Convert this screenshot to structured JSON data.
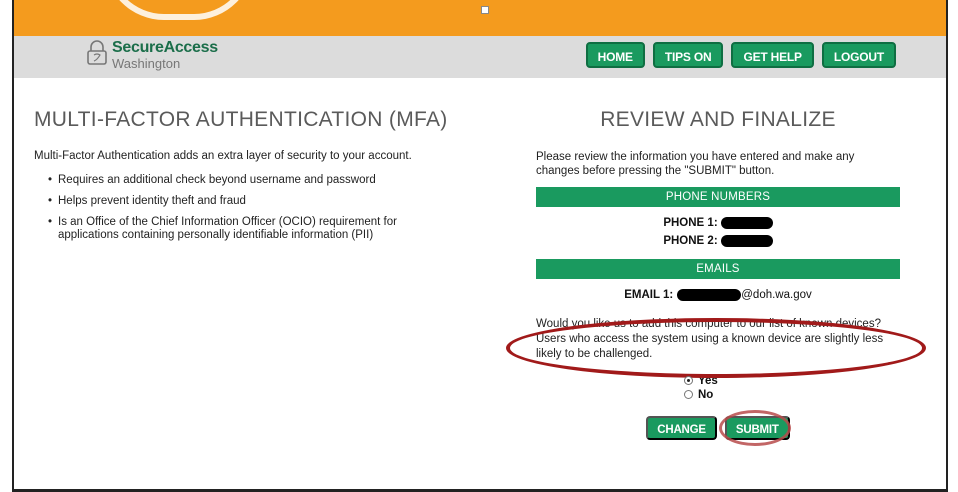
{
  "header": {
    "brand_title": "SecureAccess",
    "brand_subtitle": "Washington",
    "nav": [
      {
        "label": "HOME"
      },
      {
        "label": "TIPS ON"
      },
      {
        "label": "GET HELP"
      },
      {
        "label": "LOGOUT"
      }
    ]
  },
  "left": {
    "heading": "MULTI-FACTOR AUTHENTICATION (MFA)",
    "intro": "Multi-Factor Authentication adds an extra layer of security to your account.",
    "bullets": [
      "Requires an additional check beyond username and password",
      "Helps prevent identity theft and fraud",
      "Is an Office of the Chief Information Officer (OCIO) requirement for applications containing personally identifiable information (PII)"
    ],
    "bullet_glyph": "•"
  },
  "right": {
    "heading": "REVIEW AND FINALIZE",
    "review_text": "Please review the information you have entered and make any changes before pressing the \"SUBMIT\" button.",
    "phone_section": "PHONE NUMBERS",
    "phone1_label": "PHONE 1:",
    "phone2_label": "PHONE 2:",
    "emails_section": "EMAILS",
    "email1_label": "EMAIL 1:",
    "email1_domain": "@doh.wa.gov",
    "known_device_text": "Would you like us to add this computer to our list of known devices? Users who access the system using a known device are slightly less likely to be challenged.",
    "options": [
      {
        "label": "Yes",
        "selected": true
      },
      {
        "label": "No",
        "selected": false
      }
    ],
    "change_label": "CHANGE",
    "submit_label": "SUBMIT"
  },
  "colors": {
    "accent_orange": "#f49b1e",
    "button_green": "#1a9a5f",
    "annotation_red": "#a11a1a"
  }
}
